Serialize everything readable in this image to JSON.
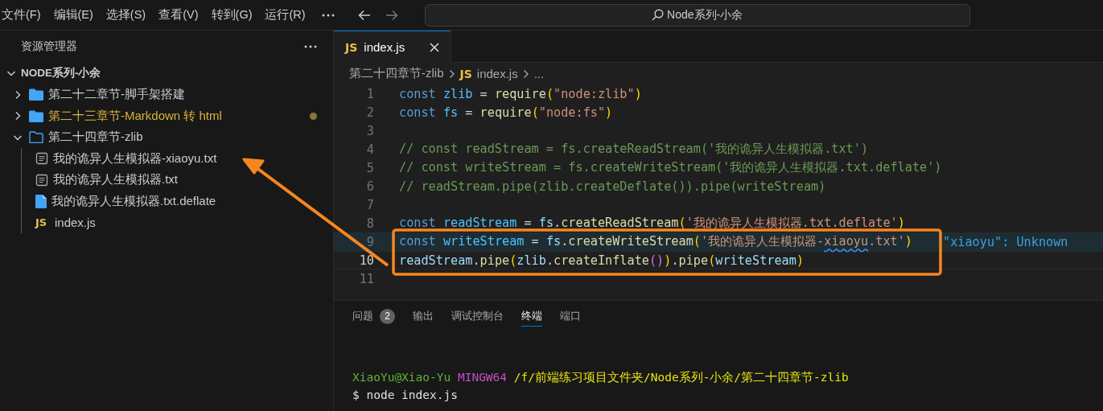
{
  "menu": [
    "文件(F)",
    "编辑(E)",
    "选择(S)",
    "查看(V)",
    "转到(G)",
    "运行(R)"
  ],
  "command_center": {
    "value": "Node系列-小余"
  },
  "explorer": {
    "title": "资源管理器",
    "root": {
      "label": "NODE系列-小余",
      "expanded": true,
      "children": [
        {
          "label": "第二十二章节-脚手架搭建",
          "kind": "folder",
          "expanded": false,
          "modified": false
        },
        {
          "label": "第二十三章节-Markdown 转 html",
          "kind": "folder",
          "expanded": false,
          "modified": true
        },
        {
          "label": "第二十四章节-zlib",
          "kind": "folder",
          "expanded": true,
          "modified": false,
          "children": [
            {
              "label": "我的诡异人生模拟器-xiaoyu.txt",
              "kind": "text",
              "modified": false
            },
            {
              "label": "我的诡异人生模拟器.txt",
              "kind": "text",
              "modified": false
            },
            {
              "label": "我的诡异人生模拟器.txt.deflate",
              "kind": "binary",
              "modified": false
            },
            {
              "label": "index.js",
              "kind": "js",
              "icon_label": "JS",
              "modified": false
            }
          ]
        }
      ]
    }
  },
  "editor_tabs": [
    {
      "label": "index.js",
      "icon_label": "JS",
      "selected": true
    }
  ],
  "breadcrumb": [
    {
      "label": "第二十四章节-zlib",
      "kind": "folder"
    },
    {
      "label": "index.js",
      "kind": "js",
      "icon_label": "JS"
    },
    {
      "label": "...",
      "kind": "more"
    }
  ],
  "code_lines": [
    {
      "number": "1",
      "current": false,
      "tokens": [
        {
          "text": "const ",
          "kind": "keyword"
        },
        {
          "text": "zlib",
          "kind": "constant"
        },
        {
          "text": " = ",
          "kind": "plain"
        },
        {
          "text": "require",
          "kind": "function"
        },
        {
          "text": "(",
          "kind": "bracket1"
        },
        {
          "text": "\"node:zlib\"",
          "kind": "string"
        },
        {
          "text": ")",
          "kind": "bracket1"
        }
      ]
    },
    {
      "number": "2",
      "current": false,
      "tokens": [
        {
          "text": "const ",
          "kind": "keyword"
        },
        {
          "text": "fs",
          "kind": "constant"
        },
        {
          "text": " = ",
          "kind": "plain"
        },
        {
          "text": "require",
          "kind": "function"
        },
        {
          "text": "(",
          "kind": "bracket1"
        },
        {
          "text": "\"node:fs\"",
          "kind": "string"
        },
        {
          "text": ")",
          "kind": "bracket1"
        }
      ]
    },
    {
      "number": "3",
      "current": false
    },
    {
      "number": "4",
      "current": false,
      "tokens": [
        {
          "text": "// const readStream = fs.createReadStream('我的诡异人生模拟器.txt')",
          "kind": "comment"
        }
      ]
    },
    {
      "number": "5",
      "current": false,
      "tokens": [
        {
          "text": "// const writeStream = fs.createWriteStream('我的诡异人生模拟器.txt.deflate')",
          "kind": "comment"
        }
      ]
    },
    {
      "number": "6",
      "current": false,
      "tokens": [
        {
          "text": "// readStream.pipe(zlib.createDeflate()).pipe(writeStream)",
          "kind": "comment"
        }
      ]
    },
    {
      "number": "7",
      "current": false
    },
    {
      "number": "8",
      "current": false,
      "tokens": [
        {
          "text": "const ",
          "kind": "keyword"
        },
        {
          "text": "readStream",
          "kind": "constant"
        },
        {
          "text": " = ",
          "kind": "plain"
        },
        {
          "text": "fs",
          "kind": "variable"
        },
        {
          "text": ".",
          "kind": "plain"
        },
        {
          "text": "createReadStream",
          "kind": "function"
        },
        {
          "text": "(",
          "kind": "bracket1"
        },
        {
          "text": "'我的诡异人生模拟器.txt.deflate'",
          "kind": "string"
        },
        {
          "text": ")",
          "kind": "bracket1"
        }
      ]
    },
    {
      "number": "9",
      "current": false,
      "diagnostic": "\"xiaoyu\": Unknown",
      "tokens": [
        {
          "text": "const ",
          "kind": "keyword"
        },
        {
          "text": "writeStream",
          "kind": "constant"
        },
        {
          "text": " = ",
          "kind": "plain"
        },
        {
          "text": "fs",
          "kind": "variable"
        },
        {
          "text": ".",
          "kind": "plain"
        },
        {
          "text": "createWriteStream",
          "kind": "function"
        },
        {
          "text": "(",
          "kind": "bracket1"
        },
        {
          "text": "'我的诡异人生模拟器-",
          "kind": "string"
        },
        {
          "text": "xiaoyu",
          "kind": "misspelled"
        },
        {
          "text": ".txt'",
          "kind": "string"
        },
        {
          "text": ")",
          "kind": "bracket1"
        }
      ]
    },
    {
      "number": "10",
      "current": true,
      "tokens": [
        {
          "text": "readStream",
          "kind": "variable"
        },
        {
          "text": ".",
          "kind": "plain"
        },
        {
          "text": "pipe",
          "kind": "function"
        },
        {
          "text": "(",
          "kind": "bracket1"
        },
        {
          "text": "zlib",
          "kind": "variable"
        },
        {
          "text": ".",
          "kind": "plain"
        },
        {
          "text": "createInflate",
          "kind": "function"
        },
        {
          "text": "()",
          "kind": "bracket2"
        },
        {
          "text": ")",
          "kind": "bracket1"
        },
        {
          "text": ".",
          "kind": "plain"
        },
        {
          "text": "pipe",
          "kind": "function"
        },
        {
          "text": "(",
          "kind": "bracket1"
        },
        {
          "text": "writeStream",
          "kind": "variable"
        },
        {
          "text": ")",
          "kind": "bracket1"
        }
      ]
    },
    {
      "number": "11",
      "current": false
    }
  ],
  "panel_tabs": [
    {
      "label": "问题",
      "badge": "2",
      "selected": false
    },
    {
      "label": "输出",
      "selected": false
    },
    {
      "label": "调试控制台",
      "selected": false
    },
    {
      "label": "终端",
      "selected": true
    },
    {
      "label": "端口",
      "selected": false
    }
  ],
  "terminal_lines": [
    [
      {
        "text": "XiaoYu@Xiao-Yu ",
        "kind": "user"
      },
      {
        "text": "MINGW64 ",
        "kind": "system"
      },
      {
        "text": "/f/前端练习项目文件夹/Node系列-小余/第二十四章节-zlib",
        "kind": "path"
      }
    ],
    [
      {
        "text": "$ node index.js",
        "kind": "plain"
      }
    ]
  ]
}
